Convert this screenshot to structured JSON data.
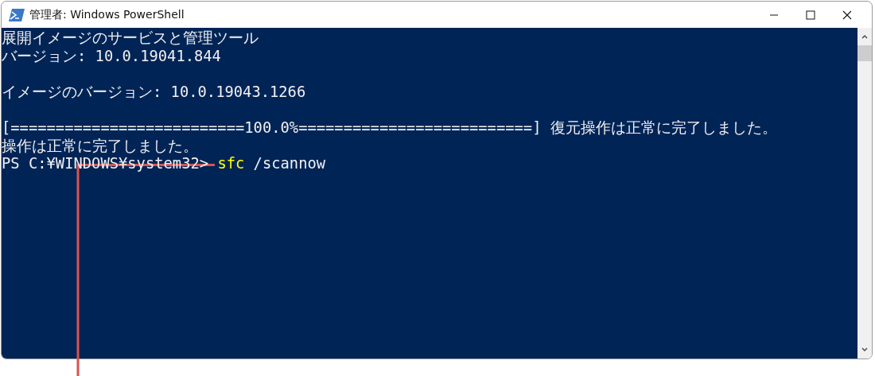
{
  "window": {
    "title": "管理者: Windows PowerShell"
  },
  "console": {
    "lines": [
      {
        "gap_before": false,
        "segments": [
          {
            "kind": "output",
            "text": "展開イメージのサービスと管理ツール"
          }
        ]
      },
      {
        "gap_before": false,
        "segments": [
          {
            "kind": "output",
            "text": "バージョン: 10.0.19041.844"
          }
        ]
      },
      {
        "gap_before": true,
        "segments": [
          {
            "kind": "output",
            "text": "イメージのバージョン: 10.0.19043.1266"
          }
        ]
      },
      {
        "gap_before": true,
        "segments": [
          {
            "kind": "output",
            "text": "[==========================100.0%==========================] 復元操作は正常に完了しました。"
          }
        ]
      },
      {
        "gap_before": false,
        "segments": [
          {
            "kind": "output",
            "text": "操作は正常に完了しました。"
          }
        ]
      },
      {
        "gap_before": false,
        "segments": [
          {
            "kind": "prompt",
            "text": "PS C:¥WINDOWS¥system32> "
          },
          {
            "kind": "command",
            "text": "sfc"
          },
          {
            "kind": "argument",
            "text": " /scannow"
          }
        ]
      }
    ]
  }
}
